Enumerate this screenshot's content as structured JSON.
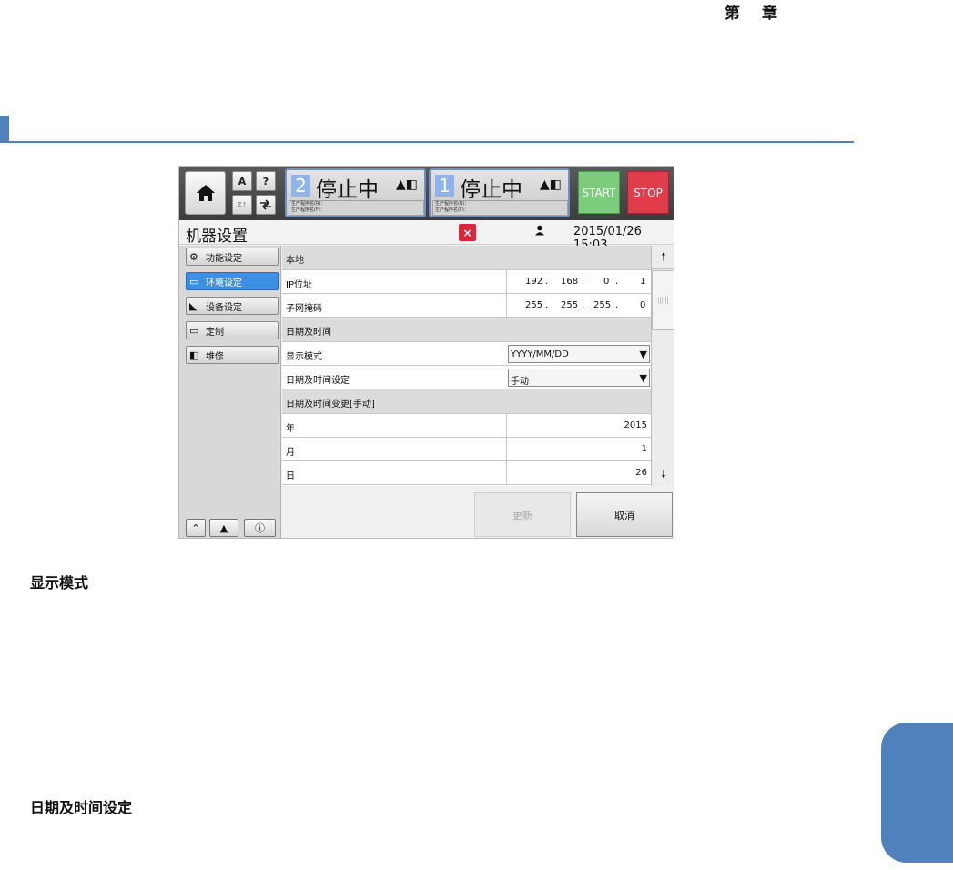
{
  "page": {
    "chapter_first": "第",
    "chapter_second": "章",
    "caption_display_mode": "显示模式",
    "caption_datetime_setting": "日期及时间设定"
  },
  "topbar": {
    "a_button": "A",
    "help_button": "?",
    "dim_button": "Z↑",
    "unit2": {
      "number": "2",
      "state": "停止中",
      "info_line1": "生产程序名(R)：",
      "info_line2": "生产程序名(F)："
    },
    "unit1": {
      "number": "1",
      "state": "停止中",
      "info_line1": "生产程序名(R)：",
      "info_line2": "生产程序名(F)："
    },
    "start_label": "START",
    "stop_label": "STOP"
  },
  "titlebar": {
    "title": "机器设置",
    "close_label": "×",
    "datetime": "2015/01/26 15:03"
  },
  "sidebar": {
    "items": [
      {
        "label": "功能设定",
        "active": false
      },
      {
        "label": "环境设定",
        "active": true
      },
      {
        "label": "设备设定",
        "active": false
      },
      {
        "label": "定制",
        "active": false
      },
      {
        "label": "维修",
        "active": false
      }
    ]
  },
  "settings": {
    "section_local": "本地",
    "ip_label": "IP位址",
    "ip": [
      "192",
      ".",
      "168",
      ".",
      "0",
      ".",
      "1"
    ],
    "subnet_label": "子网掩码",
    "subnet": [
      "255",
      ".",
      "255",
      ".",
      "255",
      ".",
      "0"
    ],
    "section_datetime": "日期及时间",
    "display_mode_label": "显示模式",
    "display_mode_value": "YYYY/MM/DD",
    "datetime_setting_label": "日期及时间设定",
    "datetime_setting_value": "手动",
    "section_change": "日期及时间变更[手动]",
    "year_label": "年",
    "year_value": "2015",
    "month_label": "月",
    "month_value": "1",
    "day_label": "日",
    "day_value": "26"
  },
  "footer": {
    "update_label": "更新",
    "cancel_label": "取消"
  },
  "colors": {
    "accent_blue": "#4f81bd",
    "active_nav": "#3d8fe6",
    "start_green": "#7ccc7c",
    "stop_red": "#e03c4a"
  }
}
